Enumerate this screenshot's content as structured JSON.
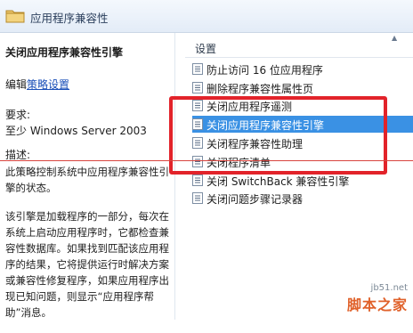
{
  "header": {
    "title": "应用程序兼容性"
  },
  "left_pane": {
    "policy_title": "关闭应用程序兼容性引擎",
    "edit_prefix": "编辑",
    "edit_link": "策略设置",
    "requirements_label": "要求:",
    "requirements_value": "至少 Windows Server 2003",
    "description_label": "描述:",
    "description_p1": "此策略控制系统中应用程序兼容性引擎的状态。",
    "description_p2": "该引擎是加载程序的一部分，每次在系统上启动应用程序时，它都检查兼容性数据库。如果找到匹配该应用程序的结果，它将提供运行时解决方案或兼容性修复程序，如果应用程序出现已知问题，则显示“应用程序帮助”消息。"
  },
  "right_pane": {
    "column_header": "设置",
    "items": [
      {
        "label": "防止访问 16 位应用程序"
      },
      {
        "label": "删除程序兼容性属性页"
      },
      {
        "label": "关闭应用程序遥测"
      },
      {
        "label": "关闭应用程序兼容性引擎"
      },
      {
        "label": "关闭程序兼容性助理"
      },
      {
        "label": "关闭程序清单"
      },
      {
        "label": "关闭 SwitchBack 兼容性引擎"
      },
      {
        "label": "关闭问题步骤记录器"
      }
    ],
    "selected_index": 3
  },
  "watermark": {
    "url": "jb51.net",
    "name": "脚本之家"
  },
  "colors": {
    "selection": "#3a91e4",
    "highlight_box": "#e2232a",
    "link": "#1a4fb8"
  }
}
